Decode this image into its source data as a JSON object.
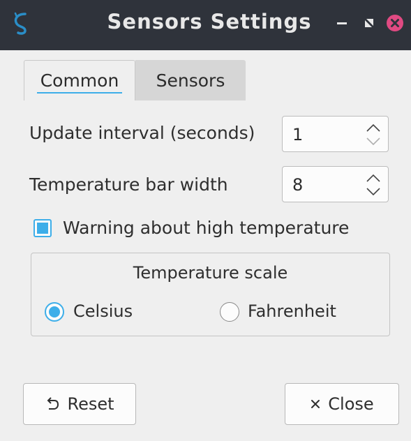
{
  "window": {
    "title": "Sensors Settings",
    "icon": "sensors-app-icon"
  },
  "titlebar_buttons": {
    "minimize": "minimize-icon",
    "maximize": "maximize-icon",
    "close": "close-icon"
  },
  "tabs": [
    {
      "label": "Common",
      "active": true
    },
    {
      "label": "Sensors",
      "active": false
    }
  ],
  "settings": {
    "update_interval_label": "Update interval (seconds)",
    "update_interval_value": "1",
    "bar_width_label": "Temperature bar width",
    "bar_width_value": "8",
    "warning_label": "Warning about high temperature",
    "warning_checked": true
  },
  "scale": {
    "title": "Temperature scale",
    "celsius_label": "Celsius",
    "fahrenheit_label": "Fahrenheit",
    "selected": "Celsius"
  },
  "buttons": {
    "reset_label": "Reset",
    "reset_icon": "undo-icon",
    "close_label": "Close",
    "close_icon": "x-icon"
  },
  "colors": {
    "accent": "#3daee9",
    "titlebar": "#2f333b",
    "close_button": "#e04a82"
  }
}
